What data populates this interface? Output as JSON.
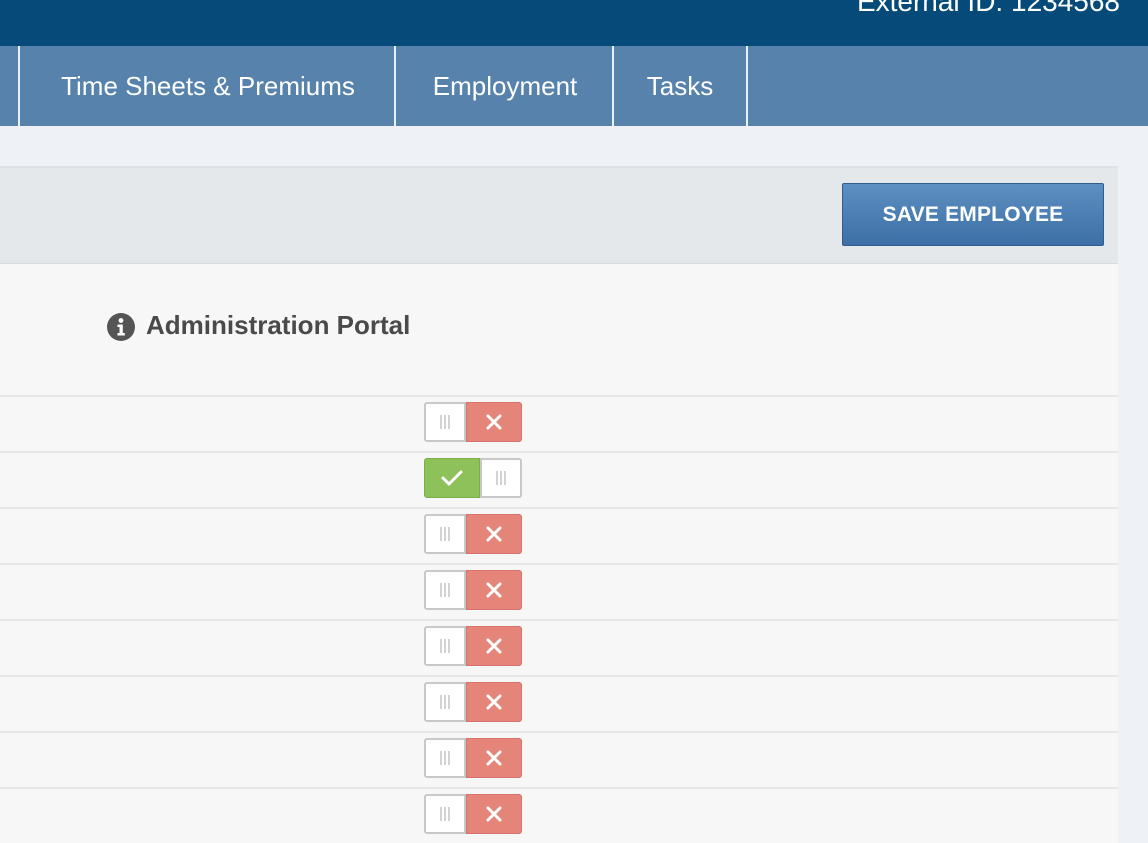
{
  "header": {
    "external_id": "External ID: 1234568"
  },
  "tabs": [
    {
      "label": "Time Sheets & Premiums"
    },
    {
      "label": "Employment"
    },
    {
      "label": "Tasks"
    }
  ],
  "toolbar": {
    "save_label": "SAVE EMPLOYEE"
  },
  "section": {
    "title": "Administration Portal",
    "icon": "info-circle-icon"
  },
  "toggles": [
    {
      "on": false
    },
    {
      "on": true
    },
    {
      "on": false
    },
    {
      "on": false
    },
    {
      "on": false
    },
    {
      "on": false
    },
    {
      "on": false
    },
    {
      "on": false
    }
  ],
  "colors": {
    "topbar": "#054a78",
    "tabbar": "#5682ab",
    "save_button": "#4a7db2",
    "toggle_off": "#e5857a",
    "toggle_on": "#8fc15a"
  }
}
